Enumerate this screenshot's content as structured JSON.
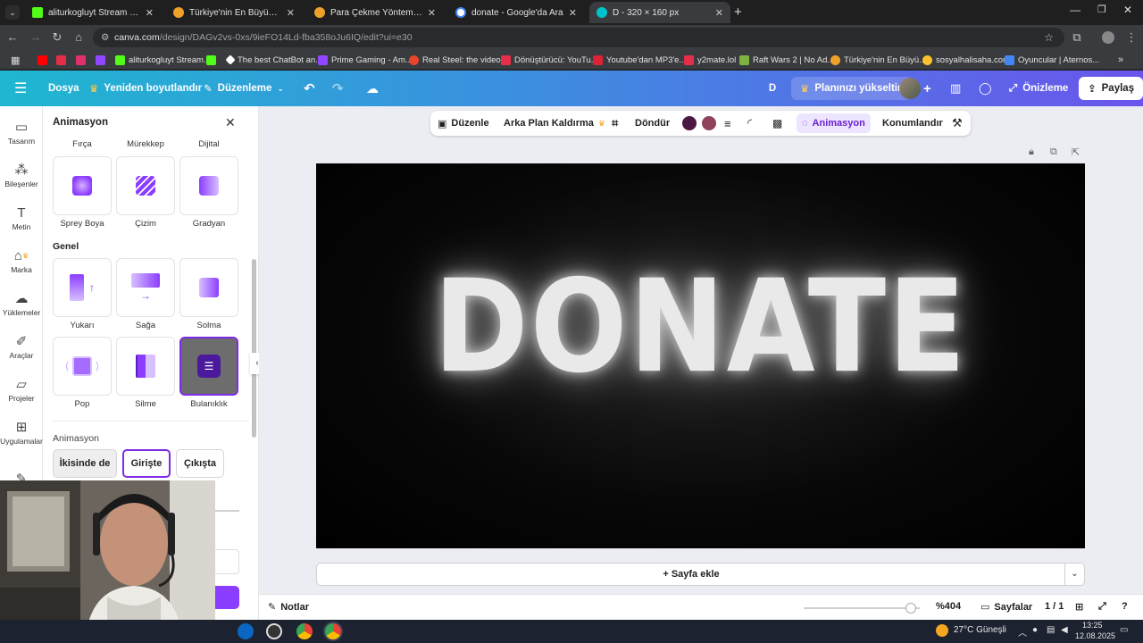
{
  "browser": {
    "tabs": [
      {
        "title": "aliturkogluyt Stream - Watch Li",
        "favicon_color": "#53fc18"
      },
      {
        "title": "Türkiye'nin En Büyük Oyuncu D",
        "favicon_color": "#f0a12a"
      },
      {
        "title": "Para Çekme Yöntemlerim",
        "favicon_color": "#f0a12a"
      },
      {
        "title": "donate - Google'da Ara",
        "favicon_color": "#4285f4"
      },
      {
        "title": "D - 320 × 160 px",
        "favicon_color": "#00c4cc"
      }
    ],
    "url_host": "canva.com",
    "url_path": "/design/DAGv2vs-0xs/9ieFO14Ld-fba358oJu6IQ/edit?ui=e30",
    "bookmarks": [
      {
        "label": "",
        "favicon_color": "#ff0000"
      },
      {
        "label": "",
        "favicon_color": "#e62d49"
      },
      {
        "label": "",
        "favicon_color": "#e1306c"
      },
      {
        "label": "",
        "favicon_color": "#9146ff"
      },
      {
        "label": "aliturkogluyt Stream...",
        "favicon_color": "#53fc18"
      },
      {
        "label": "",
        "favicon_color": "#53fc18"
      },
      {
        "label": "The best ChatBot an...",
        "favicon_color": "#ffffff"
      },
      {
        "label": "Prime Gaming - Am...",
        "favicon_color": "#9146ff"
      },
      {
        "label": "Real Steel: the video...",
        "favicon_color": "#e8452c"
      },
      {
        "label": "Dönüştürücü: YouTu...",
        "favicon_color": "#e62d49"
      },
      {
        "label": "Youtube'dan MP3'e...",
        "favicon_color": "#d23"
      },
      {
        "label": "y2mate.lol",
        "favicon_color": "#e62d49"
      },
      {
        "label": "Raft Wars 2 | No Ad...",
        "favicon_color": "#7cb342"
      },
      {
        "label": "Türkiye'nin En Büyü...",
        "favicon_color": "#f0a12a"
      },
      {
        "label": "sosyalhalisaha.com",
        "favicon_color": "#fbc02d"
      },
      {
        "label": "Oyuncular | Aternos...",
        "favicon_color": "#4285f4"
      }
    ]
  },
  "header": {
    "file": "Dosya",
    "resize": "Yeniden boyutlandır",
    "editing": "Düzenleme",
    "user_initial": "D",
    "upgrade": "Planınızı yükseltin",
    "preview": "Önizleme",
    "share": "Paylaş"
  },
  "rail": [
    {
      "label": "Tasarım",
      "icon": "layout-icon"
    },
    {
      "label": "Bileşenler",
      "icon": "shapes-icon"
    },
    {
      "label": "Metin",
      "icon": "text-icon"
    },
    {
      "label": "Marka",
      "icon": "brand-icon"
    },
    {
      "label": "Yüklemeler",
      "icon": "upload-icon"
    },
    {
      "label": "Araçlar",
      "icon": "pen-icon"
    },
    {
      "label": "Projeler",
      "icon": "folder-icon"
    },
    {
      "label": "Uygulamalar",
      "icon": "apps-icon"
    }
  ],
  "panel": {
    "title": "Animasyon",
    "top_labels": [
      "Fırça",
      "Mürekkep",
      "Dijital"
    ],
    "row1": [
      "Sprey Boya",
      "Çizim",
      "Gradyan"
    ],
    "general_title": "Genel",
    "row2": [
      "Yukarı",
      "Sağa",
      "Solma"
    ],
    "row3": [
      "Pop",
      "Silme",
      "Bulanıklık"
    ],
    "anim_title": "Animasyon",
    "modes": [
      "İkisinde de",
      "Girişte",
      "Çıkışta"
    ]
  },
  "toolbar": {
    "edit": "Düzenle",
    "bg_remove": "Arka Plan Kaldırma",
    "rotate": "Döndür",
    "animation": "Animasyon",
    "position": "Konumlandır",
    "color1": "#4a1840",
    "color2": "#8e4358"
  },
  "canvas": {
    "text": "DONATE",
    "add_page": "+ Sayfa ekle"
  },
  "footer": {
    "notes": "Notlar",
    "zoom": "%404",
    "pages": "Sayfalar",
    "page_count": "1 / 1"
  },
  "taskbar": {
    "weather": "27°C  Güneşli",
    "time": "13:25",
    "date": "12.08.2025"
  },
  "colors": {
    "accent": "#7d2ae8",
    "canva_teal": "#1fb6d0",
    "canva_purple": "#6a55ec"
  }
}
